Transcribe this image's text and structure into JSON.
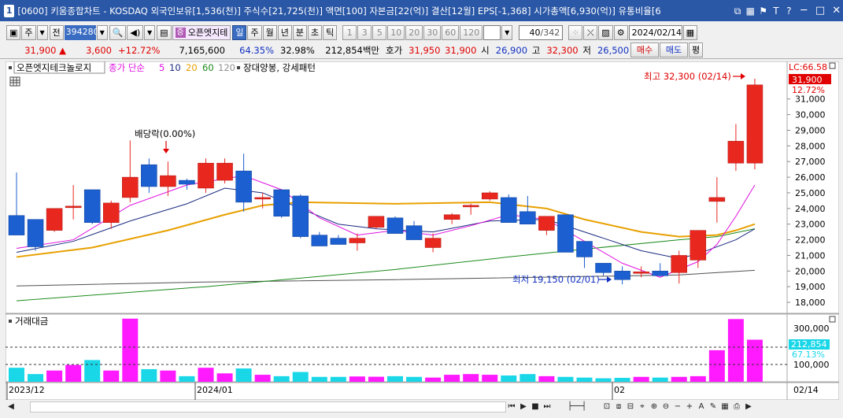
{
  "window": {
    "number": "1",
    "title": "[0600] 키움종합차트 - KOSDAQ 외국인보유[1,536(천)] 주식수[21,725(천)] 액면[100] 자본금[22(억)] 결산[12월] EPS[-1,368] 시가총액[6,930(억)] 유통비율[6"
  },
  "toolbar": {
    "type_label": "주",
    "prev_label": "전",
    "code": "394280",
    "name": "오픈엣지테",
    "name_badge": "증",
    "periods": [
      "일",
      "주",
      "월",
      "년",
      "분",
      "초",
      "틱"
    ],
    "active_period": "일",
    "intervals": [
      "1",
      "3",
      "5",
      "10",
      "20",
      "30",
      "60",
      "120"
    ],
    "count": "40",
    "total": "/342",
    "date": "2024/02/14"
  },
  "quote": {
    "price": "31,900",
    "change": "3,600",
    "rate": "+12.72%",
    "volume": "7,165,600",
    "ratio1": "64.35%",
    "ratio2": "32.98%",
    "amount": "212,854백만",
    "bid_label": "호가",
    "ask": "31,950",
    "bid": "31,900",
    "open_label": "시",
    "open": "26,900",
    "high_label": "고",
    "high": "32,300",
    "low_label": "저",
    "low": "26,500",
    "buy_label": "매수",
    "sell_label": "매도",
    "avg_label": "평"
  },
  "price_panel": {
    "stock_name": "오픈엣지테크놀로지",
    "ma_label": "종가 단순",
    "ma_periods": [
      "5",
      "10",
      "20",
      "60",
      "120"
    ],
    "ma_colors": [
      "#e010e0",
      "#1a2a80",
      "#e8a000",
      "#1a8a1a",
      "#505050"
    ],
    "pattern_label": "장대양봉, 강세패턴",
    "lc_label": "LC:66.58",
    "last_price": "31,900",
    "last_rate": "12.72%",
    "dividend_label": "배당락(0.00%)",
    "high_annotation": "최고 32,300 (02/14)",
    "low_annotation": "최저 19,150 (02/01)",
    "y_ticks": [
      "31,000",
      "30,000",
      "29,000",
      "28,000",
      "27,000",
      "26,000",
      "25,000",
      "24,000",
      "23,000",
      "22,000",
      "21,000",
      "20,000",
      "19,000",
      "18,000"
    ]
  },
  "volume_panel": {
    "label": "거래대금",
    "y_ticks": [
      "300,000",
      "100,000"
    ],
    "last_value": "212,854",
    "last_rate": "67.13%"
  },
  "x_axis": {
    "labels": [
      "2023/12",
      "2024/01",
      "02"
    ],
    "current": "02/14"
  },
  "colors": {
    "up": "#e8281e",
    "down": "#1c5fd0",
    "vol_up": "#ff1aff",
    "vol_down": "#1ad7e8"
  },
  "chart_data": {
    "type": "candlestick",
    "candles": [
      {
        "o": 23550,
        "h": 26300,
        "l": 22850,
        "c": 22300
      },
      {
        "o": 23300,
        "h": 23300,
        "l": 21300,
        "c": 21550
      },
      {
        "o": 22600,
        "h": 23900,
        "l": 22500,
        "c": 24000
      },
      {
        "o": 24100,
        "h": 25500,
        "l": 23300,
        "c": 24150
      },
      {
        "o": 25200,
        "h": 25200,
        "l": 23000,
        "c": 23100
      },
      {
        "o": 23100,
        "h": 24500,
        "l": 22700,
        "c": 24350
      },
      {
        "o": 24700,
        "h": 28350,
        "l": 24400,
        "c": 26000
      },
      {
        "o": 26800,
        "h": 27200,
        "l": 25000,
        "c": 25400
      },
      {
        "o": 25400,
        "h": 27000,
        "l": 24800,
        "c": 26100
      },
      {
        "o": 25800,
        "h": 25900,
        "l": 25200,
        "c": 25550
      },
      {
        "o": 25300,
        "h": 27200,
        "l": 25000,
        "c": 26900
      },
      {
        "o": 25800,
        "h": 27200,
        "l": 25600,
        "c": 26900
      },
      {
        "o": 26400,
        "h": 27500,
        "l": 23800,
        "c": 24400
      },
      {
        "o": 24600,
        "h": 25000,
        "l": 24000,
        "c": 24700
      },
      {
        "o": 25200,
        "h": 25200,
        "l": 23400,
        "c": 23500
      },
      {
        "o": 24800,
        "h": 24900,
        "l": 22100,
        "c": 22200
      },
      {
        "o": 22300,
        "h": 22500,
        "l": 22000,
        "c": 21600
      },
      {
        "o": 22100,
        "h": 22300,
        "l": 21800,
        "c": 21700
      },
      {
        "o": 21800,
        "h": 22400,
        "l": 21300,
        "c": 22100
      },
      {
        "o": 22800,
        "h": 23400,
        "l": 22700,
        "c": 23500
      },
      {
        "o": 23400,
        "h": 23500,
        "l": 22400,
        "c": 22400
      },
      {
        "o": 22900,
        "h": 23200,
        "l": 22000,
        "c": 22000
      },
      {
        "o": 21500,
        "h": 22400,
        "l": 21200,
        "c": 22100
      },
      {
        "o": 23300,
        "h": 23700,
        "l": 23000,
        "c": 23600
      },
      {
        "o": 24100,
        "h": 24300,
        "l": 23600,
        "c": 24200
      },
      {
        "o": 24600,
        "h": 25100,
        "l": 24500,
        "c": 25000
      },
      {
        "o": 24700,
        "h": 24900,
        "l": 23100,
        "c": 23100
      },
      {
        "o": 23800,
        "h": 24800,
        "l": 23000,
        "c": 23000
      },
      {
        "o": 22600,
        "h": 23000,
        "l": 22300,
        "c": 23500
      },
      {
        "o": 23600,
        "h": 23600,
        "l": 21300,
        "c": 21200
      },
      {
        "o": 21900,
        "h": 21900,
        "l": 20200,
        "c": 20900
      },
      {
        "o": 20500,
        "h": 20500,
        "l": 19700,
        "c": 19900
      },
      {
        "o": 20000,
        "h": 20300,
        "l": 19150,
        "c": 19450
      },
      {
        "o": 19900,
        "h": 20300,
        "l": 19600,
        "c": 19950
      },
      {
        "o": 20000,
        "h": 20500,
        "l": 19650,
        "c": 19700
      },
      {
        "o": 19900,
        "h": 21300,
        "l": 19200,
        "c": 21000
      },
      {
        "o": 20700,
        "h": 22600,
        "l": 20200,
        "c": 22600
      },
      {
        "o": 24450,
        "h": 26000,
        "l": 23100,
        "c": 24700
      },
      {
        "o": 26900,
        "h": 29400,
        "l": 26400,
        "c": 28300
      },
      {
        "o": 26900,
        "h": 32300,
        "l": 26500,
        "c": 31900
      }
    ],
    "turnover": [
      100,
      55,
      80,
      120,
      155,
      80,
      450,
      90,
      80,
      40,
      100,
      60,
      95,
      50,
      40,
      70,
      35,
      35,
      38,
      36,
      40,
      35,
      30,
      50,
      55,
      50,
      45,
      55,
      40,
      35,
      30,
      25,
      28,
      35,
      30,
      35,
      40,
      225,
      447,
      300
    ],
    "ma": {
      "5": [
        [
          0,
          21450
        ],
        [
          3,
          22000
        ],
        [
          6,
          24200
        ],
        [
          9,
          25500
        ],
        [
          12,
          26100
        ],
        [
          14,
          25200
        ],
        [
          16,
          23400
        ],
        [
          18,
          22300
        ],
        [
          20,
          22600
        ],
        [
          22,
          22300
        ],
        [
          24,
          22900
        ],
        [
          26,
          23600
        ],
        [
          28,
          23300
        ],
        [
          30,
          21900
        ],
        [
          32,
          20500
        ],
        [
          34,
          19600
        ],
        [
          36,
          20600
        ],
        [
          37,
          21700
        ],
        [
          38,
          23500
        ],
        [
          39,
          25500
        ]
      ],
      "10": [
        [
          0,
          21200
        ],
        [
          3,
          21900
        ],
        [
          6,
          23200
        ],
        [
          9,
          24300
        ],
        [
          11,
          25300
        ],
        [
          13,
          25000
        ],
        [
          15,
          24000
        ],
        [
          17,
          23000
        ],
        [
          19,
          22700
        ],
        [
          22,
          22500
        ],
        [
          25,
          23200
        ],
        [
          28,
          23300
        ],
        [
          31,
          22100
        ],
        [
          33,
          21300
        ],
        [
          35,
          20800
        ],
        [
          36,
          21100
        ],
        [
          38,
          22000
        ],
        [
          39,
          22700
        ]
      ],
      "20": [
        [
          0,
          20900
        ],
        [
          4,
          21500
        ],
        [
          8,
          22600
        ],
        [
          11,
          23600
        ],
        [
          13,
          24200
        ],
        [
          15,
          24400
        ],
        [
          20,
          24300
        ],
        [
          25,
          24400
        ],
        [
          28,
          24000
        ],
        [
          30,
          23300
        ],
        [
          33,
          22500
        ],
        [
          35,
          22200
        ],
        [
          37,
          22300
        ],
        [
          38,
          22600
        ],
        [
          39,
          23000
        ]
      ],
      "60": [
        [
          0,
          18100
        ],
        [
          10,
          19000
        ],
        [
          20,
          20100
        ],
        [
          26,
          20900
        ],
        [
          30,
          21400
        ],
        [
          35,
          22000
        ],
        [
          37,
          22200
        ],
        [
          39,
          22700
        ]
      ],
      "120": [
        [
          0,
          19050
        ],
        [
          10,
          19300
        ],
        [
          20,
          19450
        ],
        [
          30,
          19650
        ],
        [
          35,
          19750
        ],
        [
          39,
          20050
        ]
      ]
    },
    "y_range": [
      17500,
      33200
    ],
    "y2_range": [
      0,
      460
    ]
  }
}
